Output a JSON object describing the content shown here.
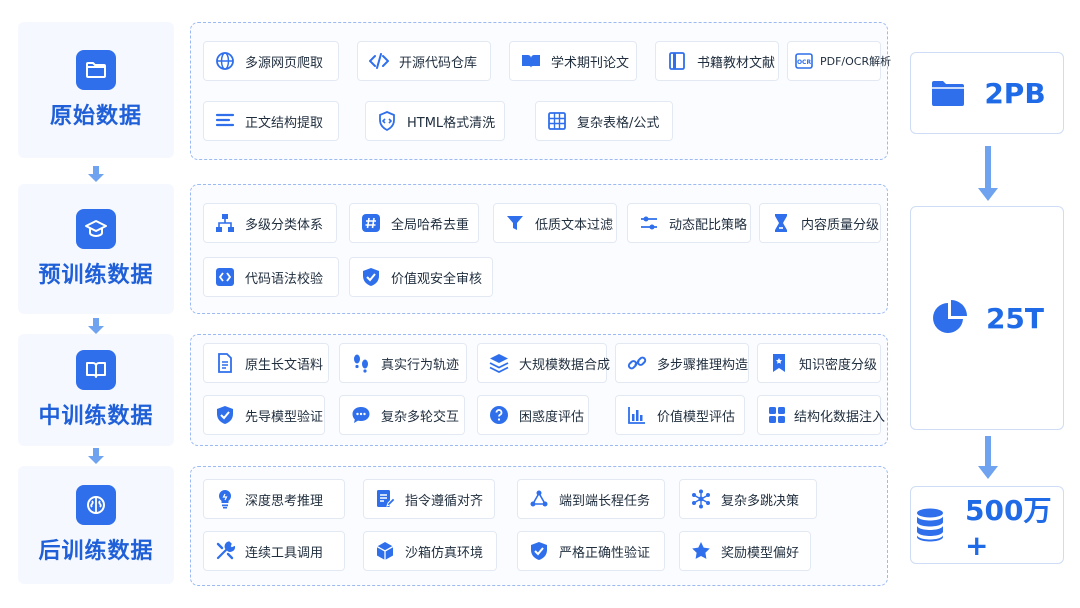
{
  "colors": {
    "accent": "#2f6fec",
    "title": "#1f5fd8",
    "arrow": "#6fa3f0"
  },
  "stages": [
    {
      "name": "原始数据",
      "icon": "folder-icon"
    },
    {
      "name": "预训练数据",
      "icon": "graduation-cap-icon"
    },
    {
      "name": "中训练数据",
      "icon": "book-icon"
    },
    {
      "name": "后训练数据",
      "icon": "brain-icon"
    }
  ],
  "raw": {
    "items": [
      {
        "label": "多源网页爬取",
        "icon": "globe-icon"
      },
      {
        "label": "开源代码仓库",
        "icon": "code-icon"
      },
      {
        "label": "学术期刊论文",
        "icon": "open-book-icon"
      },
      {
        "label": "书籍教材文献",
        "icon": "book-icon"
      },
      {
        "label": "PDF/OCR解析",
        "icon": "ocr-icon"
      },
      {
        "label": "正文结构提取",
        "icon": "text-lines-icon"
      },
      {
        "label": "HTML格式清洗",
        "icon": "shield-code-icon"
      },
      {
        "label": "复杂表格/公式",
        "icon": "table-icon"
      }
    ]
  },
  "pretrain": {
    "items": [
      {
        "label": "多级分类体系",
        "icon": "hierarchy-icon"
      },
      {
        "label": "全局哈希去重",
        "icon": "hash-icon"
      },
      {
        "label": "低质文本过滤",
        "icon": "filter-icon"
      },
      {
        "label": "动态配比策略",
        "icon": "sliders-icon"
      },
      {
        "label": "内容质量分级",
        "icon": "hourglass-icon"
      },
      {
        "label": "代码语法校验",
        "icon": "code-box-icon"
      },
      {
        "label": "价值观安全审核",
        "icon": "shield-check-icon"
      }
    ]
  },
  "midtrain": {
    "items": [
      {
        "label": "原生长文语料",
        "icon": "document-icon"
      },
      {
        "label": "真实行为轨迹",
        "icon": "footprints-icon"
      },
      {
        "label": "大规模数据合成",
        "icon": "layers-icon"
      },
      {
        "label": "多步骤推理构造",
        "icon": "link-icon"
      },
      {
        "label": "知识密度分级",
        "icon": "bookmark-icon"
      },
      {
        "label": "先导模型验证",
        "icon": "shield-check-icon"
      },
      {
        "label": "复杂多轮交互",
        "icon": "chat-icon"
      },
      {
        "label": "困惑度评估",
        "icon": "question-icon"
      },
      {
        "label": "价值模型评估",
        "icon": "bar-chart-icon"
      },
      {
        "label": "结构化数据注入",
        "icon": "grid-icon"
      }
    ]
  },
  "posttrain": {
    "items": [
      {
        "label": "深度思考推理",
        "icon": "lightbulb-icon"
      },
      {
        "label": "指令遵循对齐",
        "icon": "edit-doc-icon"
      },
      {
        "label": "端到端长程任务",
        "icon": "flow-icon"
      },
      {
        "label": "复杂多跳决策",
        "icon": "network-icon"
      },
      {
        "label": "连续工具调用",
        "icon": "tools-icon"
      },
      {
        "label": "沙箱仿真环境",
        "icon": "cube-icon"
      },
      {
        "label": "严格正确性验证",
        "icon": "shield-check-icon"
      },
      {
        "label": "奖励模型偏好",
        "icon": "star-icon"
      }
    ]
  },
  "stats": [
    {
      "value": "2PB",
      "icon": "folder-icon"
    },
    {
      "value": "25T",
      "icon": "pie-chart-icon"
    },
    {
      "value": "500万+",
      "icon": "database-icon"
    }
  ]
}
